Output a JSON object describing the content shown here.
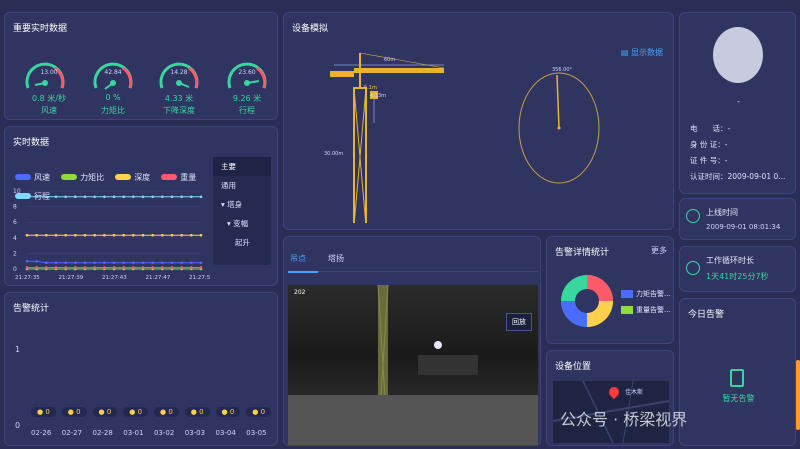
{
  "realtime_main": {
    "title": "重要实时数据",
    "gauges": [
      {
        "name": "wind",
        "center_value": "13.00",
        "value": "0.8 米/秒",
        "label": "风速"
      },
      {
        "name": "torque",
        "center_value": "42.84",
        "value": "0 %",
        "label": "力矩比"
      },
      {
        "name": "depth",
        "center_value": "14.28",
        "value": "4.33 米",
        "label": "下降深度"
      },
      {
        "name": "travel",
        "center_value": "23.60",
        "value": "9.26 米",
        "label": "行程"
      }
    ]
  },
  "realtime_chart": {
    "title": "实时数据",
    "legend": [
      "风速",
      "力矩比",
      "深度",
      "重量",
      "行程"
    ],
    "y_ticks": [
      "10",
      "8",
      "6",
      "4",
      "2",
      "0"
    ],
    "x_ticks": [
      "21:27:35",
      "21:27:39",
      "21:27:43",
      "21:27:47",
      "21:27:51"
    ],
    "menu": [
      "主要",
      "通用",
      "塔身",
      "变幅",
      "起升"
    ]
  },
  "chart_data": {
    "type": "line",
    "x": [
      "21:27:35",
      "21:27:36",
      "21:27:37",
      "21:27:38",
      "21:27:39",
      "21:27:40",
      "21:27:41",
      "21:27:42",
      "21:27:43",
      "21:27:44",
      "21:27:45",
      "21:27:46",
      "21:27:47",
      "21:27:48",
      "21:27:49",
      "21:27:50",
      "21:27:51",
      "21:27:52",
      "21:27:53"
    ],
    "ylim": [
      0,
      10
    ],
    "series": [
      {
        "name": "风速",
        "color": "#4a6cff",
        "values": [
          1,
          1,
          0.8,
          0.8,
          0.8,
          0.8,
          0.8,
          0.8,
          0.8,
          0.8,
          0.8,
          0.8,
          0.8,
          0.8,
          0.8,
          0.8,
          0.8,
          0.8,
          0.8
        ]
      },
      {
        "name": "力矩比",
        "color": "#8fdc3a",
        "values": [
          0,
          0,
          0,
          0,
          0,
          0,
          0,
          0,
          0,
          0,
          0,
          0,
          0,
          0,
          0,
          0,
          0,
          0,
          0
        ]
      },
      {
        "name": "深度",
        "color": "#ffd04a",
        "values": [
          4.33,
          4.33,
          4.33,
          4.33,
          4.33,
          4.33,
          4.33,
          4.33,
          4.33,
          4.33,
          4.33,
          4.33,
          4.33,
          4.33,
          4.33,
          4.33,
          4.33,
          4.33,
          4.33
        ]
      },
      {
        "name": "重量",
        "color": "#ff5a6a",
        "values": [
          0.2,
          0.2,
          0.2,
          0.2,
          0.2,
          0.2,
          0.2,
          0.2,
          0.2,
          0.2,
          0.2,
          0.2,
          0.2,
          0.2,
          0.2,
          0.2,
          0.2,
          0.2,
          0.2
        ]
      },
      {
        "name": "行程",
        "color": "#7fd8ff",
        "values": [
          9.26,
          9.26,
          9.26,
          9.26,
          9.26,
          9.26,
          9.26,
          9.26,
          9.26,
          9.26,
          9.26,
          9.26,
          9.26,
          9.26,
          9.26,
          9.26,
          9.26,
          9.26,
          9.26
        ]
      }
    ]
  },
  "alarm_stats": {
    "title": "告警统计",
    "y_ticks": [
      "1",
      "0"
    ],
    "dates": [
      "02-26",
      "02-27",
      "02-28",
      "03-01",
      "03-02",
      "03-03",
      "03-04",
      "03-05"
    ],
    "counts": [
      "0",
      "0",
      "0",
      "0",
      "0",
      "0",
      "0",
      "0"
    ]
  },
  "device_model": {
    "title": "设备模拟",
    "show_data": "显示数据",
    "jib_len": "60m",
    "tower_h": "30.00m",
    "trolley": "5.1m",
    "hook": "4.33m",
    "angle": "356.00°"
  },
  "camera": {
    "tabs": [
      "吊点",
      "塔扬"
    ],
    "label": "202",
    "back": "回放"
  },
  "alarm_detail": {
    "title": "告警详情统计",
    "more": "更多",
    "legend": [
      "力矩告警...",
      "重量告警..."
    ]
  },
  "location": {
    "title": "设备位置",
    "map_text": "佳木斯"
  },
  "profile": {
    "name": "-",
    "rows": [
      {
        "k": "电　　话：",
        "v": "-"
      },
      {
        "k": "身 份 证：",
        "v": "-"
      },
      {
        "k": "证 件 号：",
        "v": "-"
      },
      {
        "k": "认证时间：",
        "v": "2009-09-01 0..."
      }
    ]
  },
  "online": {
    "title": "上线时间",
    "value": "2009-09-01 08:01:34"
  },
  "cycle": {
    "title": "工作循环时长",
    "value": "1天41时25分7秒"
  },
  "today_alarm": {
    "title": "今日告警",
    "empty": "暂无告警"
  },
  "watermark": "公众号 · 桥梁视界"
}
